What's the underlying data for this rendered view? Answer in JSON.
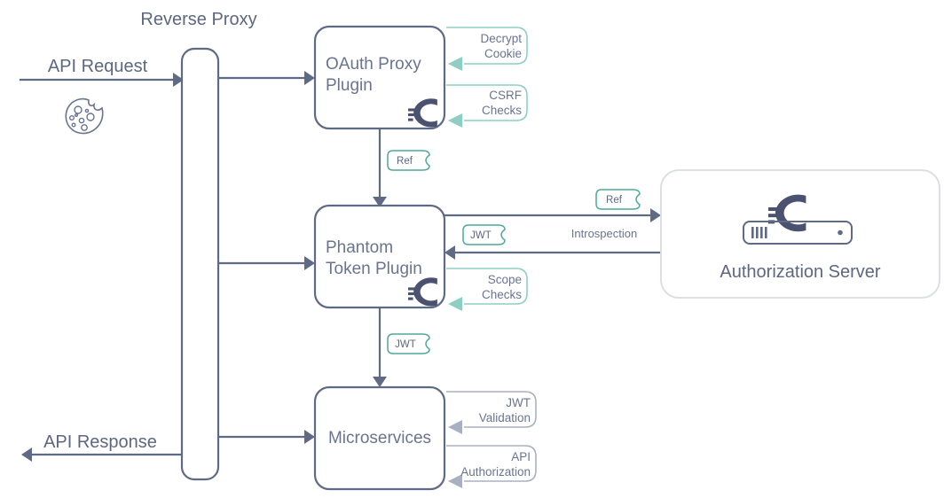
{
  "diagram": {
    "title": "Reverse Proxy",
    "type": "architecture-flow",
    "background_color": "#ffffff",
    "colors": {
      "primary_stroke": "#5f6a84",
      "node_text": "#6a7490",
      "teal_accent": "#8ecfc4",
      "tag_border": "#4fa89a",
      "gray_accent": "#a8b0c2",
      "as_border": "#dcdfe6",
      "curity_mark": "#4a5270"
    }
  },
  "io": {
    "request_label": "API Request",
    "response_label": "API Response",
    "cookie_icon": "cookie-icon"
  },
  "reverse_proxy": {
    "label": "Reverse Proxy"
  },
  "nodes": [
    {
      "id": "oauth-proxy-plugin",
      "line1": "OAuth Proxy",
      "line2": "Plugin",
      "badge_icon": "curity-logo-icon"
    },
    {
      "id": "phantom-token-plugin",
      "line1": "Phantom",
      "line2": "Token Plugin",
      "badge_icon": "curity-logo-icon"
    },
    {
      "id": "microservices",
      "line1": "Microservices",
      "line2": "",
      "badge_icon": ""
    }
  ],
  "authorization_server": {
    "label": "Authorization Server",
    "logo_icon": "curity-logo-icon",
    "server_icon": "server-rack-icon"
  },
  "callouts": {
    "oauth": [
      {
        "line1": "Decrypt",
        "line2": "Cookie",
        "style": "teal"
      },
      {
        "line1": "CSRF",
        "line2": "Checks",
        "style": "teal"
      }
    ],
    "phantom": [
      {
        "line1": "Scope",
        "line2": "Checks",
        "style": "teal"
      }
    ],
    "microservices": [
      {
        "line1": "JWT",
        "line2": "Validation",
        "style": "gray"
      },
      {
        "line1": "API",
        "line2": "Authorization",
        "style": "gray"
      }
    ]
  },
  "tags": [
    {
      "id": "tag-ref-oauth-to-phantom",
      "text": "Ref"
    },
    {
      "id": "tag-ref-introspection",
      "text": "Ref"
    },
    {
      "id": "tag-jwt-introspection-response",
      "text": "JWT"
    },
    {
      "id": "tag-jwt-phantom-to-micro",
      "text": "JWT"
    }
  ],
  "edges": [
    {
      "id": "edge-introspection",
      "label": "Introspection"
    }
  ]
}
